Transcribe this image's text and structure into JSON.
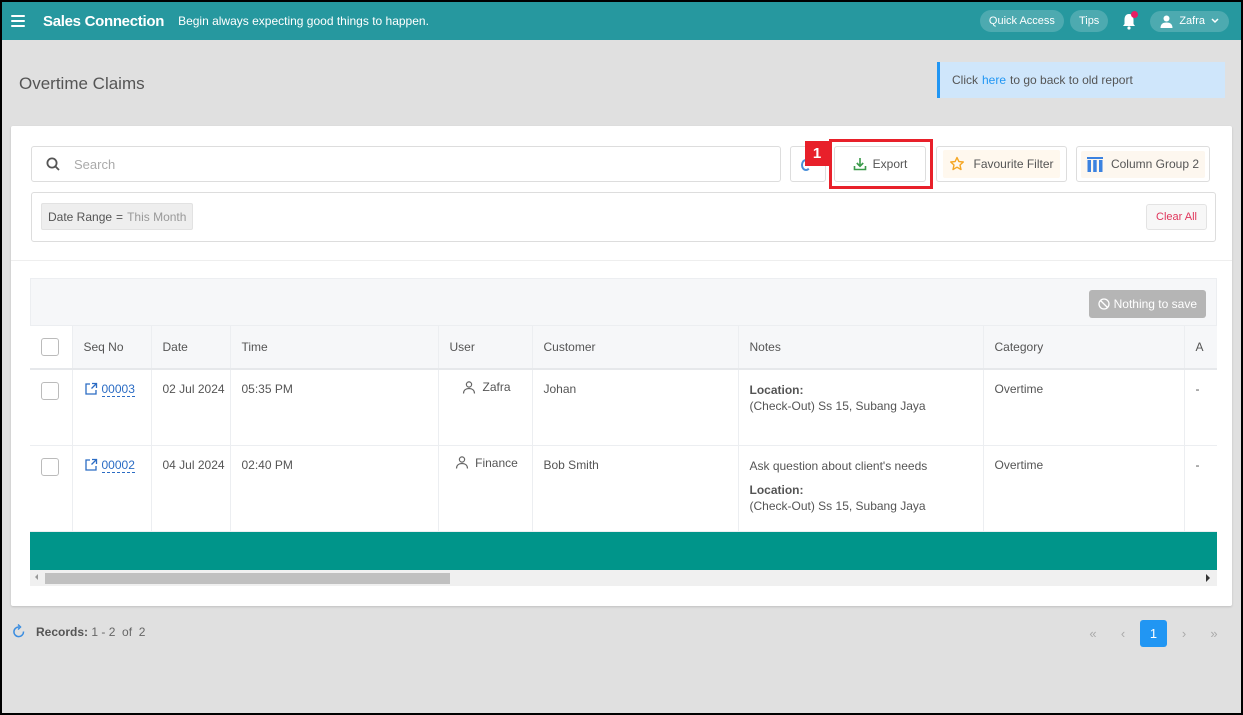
{
  "topbar": {
    "brand": "Sales Connection",
    "tagline": "Begin always expecting good things to happen.",
    "quick_access": "Quick Access",
    "tips": "Tips",
    "user_name": "Zafra",
    "accent_color": "#26989f"
  },
  "page": {
    "title": "Overtime Claims",
    "old_report": {
      "prefix": "Click",
      "link": "here",
      "suffix": "to go back to old report"
    }
  },
  "toolbar": {
    "search_placeholder": "Search",
    "search_value": "",
    "export_label": "Export",
    "favourite_label": "Favourite Filter",
    "column_group_label": "Column Group 2",
    "step_badge": "1"
  },
  "filters": {
    "chip_key": "Date Range",
    "chip_op": "=",
    "chip_value": "This Month",
    "clear_all": "Clear All"
  },
  "grid": {
    "save_label": "Nothing to save",
    "columns": [
      "Seq No",
      "Date",
      "Time",
      "User",
      "Customer",
      "Notes",
      "Category",
      "A"
    ],
    "rows": [
      {
        "seq": "00003",
        "date": "02 Jul 2024",
        "time": "05:35 PM",
        "user": "Zafra",
        "customer": "Johan",
        "note_text": "",
        "location_label": "Location:",
        "location": "(Check-Out) Ss 15, Subang Jaya",
        "category": "Overtime",
        "extra": "-"
      },
      {
        "seq": "00002",
        "date": "04 Jul 2024",
        "time": "02:40 PM",
        "user": "Finance",
        "customer": "Bob Smith",
        "note_text": "Ask question about client's needs",
        "location_label": "Location:",
        "location": "(Check-Out) Ss 15, Subang Jaya",
        "category": "Overtime",
        "extra": "-"
      }
    ]
  },
  "footer": {
    "records_label": "Records:",
    "records_range": "1 - 2",
    "records_of": "of",
    "records_total": "2",
    "current_page": "1",
    "first": "«",
    "prev": "‹",
    "next": "›",
    "last": "»"
  }
}
